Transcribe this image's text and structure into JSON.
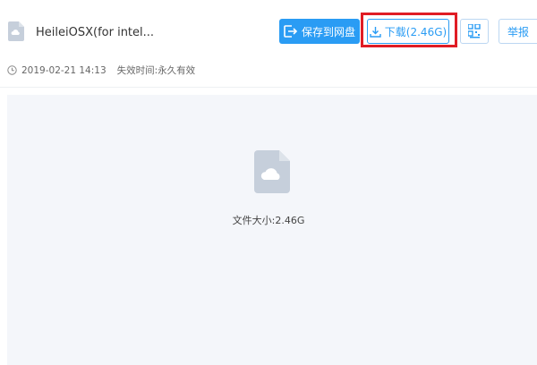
{
  "file": {
    "title": "HeileiOSX(for intel...",
    "date": "2019-02-21 14:13",
    "expire_label": "失效时间:",
    "expire_value": "永久有效",
    "size_text": "文件大小:2.46G"
  },
  "toolbar": {
    "save_label": "保存到网盘",
    "download_label": "下载(2.46G)",
    "report_label": "举报"
  },
  "colors": {
    "accent": "#2a9cf4",
    "highlight": "#e01c24",
    "icon_gray": "#c6cfdb",
    "preview_bg": "#f4f6fa"
  },
  "icons": [
    "file-cloud-icon",
    "save-to-disk-icon",
    "download-icon",
    "qr-code-icon",
    "clock-icon"
  ]
}
